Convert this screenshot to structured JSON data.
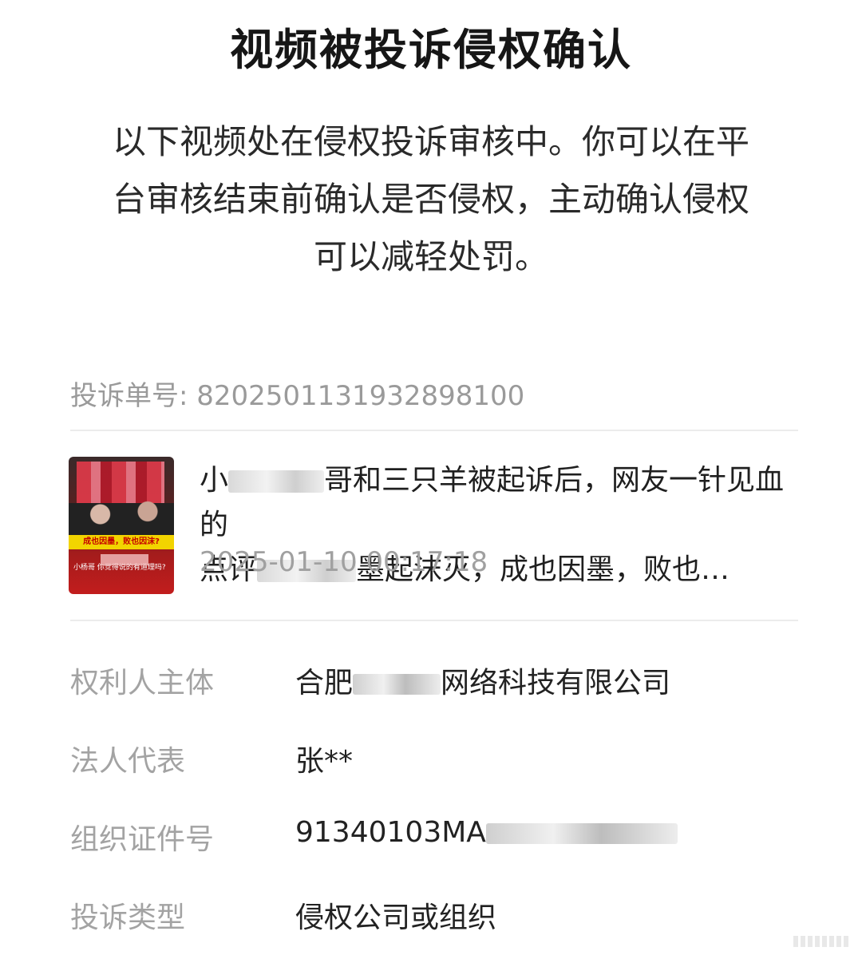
{
  "header": {
    "title": "视频被投诉侵权确认"
  },
  "notice": {
    "line1": "以下视频处在侵权投诉审核中。你可以在平",
    "line2": "台审核结束前确认是否侵权，主动确认侵权",
    "line3": "可以减轻处罚。"
  },
  "complaint": {
    "number_text": "投诉单号: 8202501131932898100"
  },
  "video": {
    "thumbnail_caption_band": "成也因墨，败也因沫?",
    "thumbnail_caption_bottom": "小杨哥 你觉得说的有道理吗?",
    "title_part1": "小",
    "title_part2": "哥和三只羊被起诉后，网友一针见血的",
    "title_part3": "点评",
    "title_part4": "墨起沫灭，成也因墨，败也…",
    "timestamp": "2025-01-10 00:17:18"
  },
  "details": {
    "rights_holder_label": "权利人主体",
    "rights_holder_prefix": "合肥",
    "rights_holder_suffix": "网络科技有限公司",
    "legal_rep_label": "法人代表",
    "legal_rep_value": "张**",
    "org_id_label": "组织证件号",
    "org_id_prefix": "91340103MA",
    "complaint_type_label": "投诉类型",
    "complaint_type_value": "侵权公司或组织"
  }
}
